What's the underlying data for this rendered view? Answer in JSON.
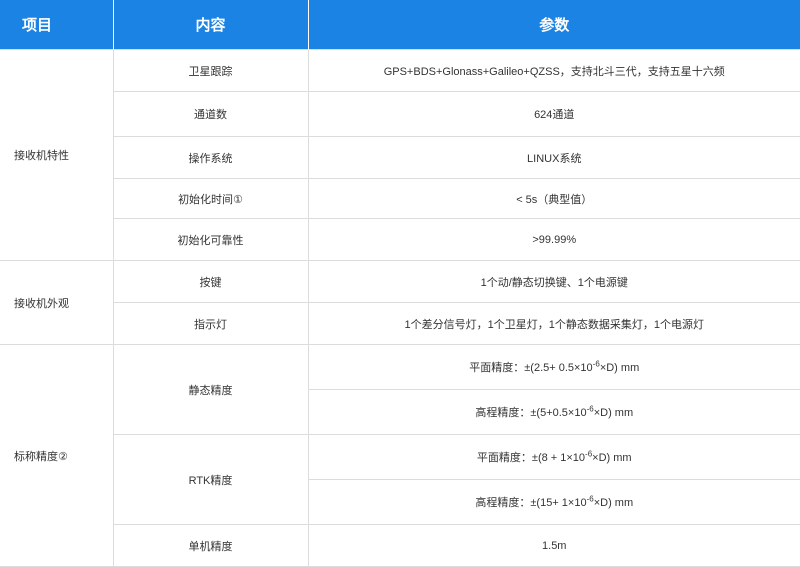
{
  "header": {
    "col1": "项目",
    "col2": "内容",
    "col3": "参数"
  },
  "groups": [
    {
      "label": "接收机特性",
      "rows": [
        {
          "item": "卫星跟踪",
          "value": "GPS+BDS+Glonass+Galileo+QZSS，支持北斗三代，支持五星十六频"
        },
        {
          "item": "通道数",
          "value": "624通道"
        },
        {
          "item": "操作系统",
          "value": "LINUX系统"
        },
        {
          "item": "初始化时间①",
          "value": "< 5s（典型值）"
        },
        {
          "item": "初始化可靠性",
          "value": ">99.99%"
        }
      ]
    },
    {
      "label": "接收机外观",
      "rows": [
        {
          "item": "按键",
          "value": "1个动/静态切换键、1个电源键"
        },
        {
          "item": "指示灯",
          "value": "1个差分信号灯，1个卫星灯，1个静态数据采集灯，1个电源灯"
        }
      ]
    },
    {
      "label": "标称精度②",
      "static": {
        "item": "静态精度",
        "planar": {
          "prefix": "平面精度：±(2.5+ 0.5×10",
          "exp": "-6",
          "suffix": "×D) mm"
        },
        "height": {
          "prefix": "高程精度：±(5+0.5×10",
          "exp": "-6",
          "suffix": "×D) mm"
        }
      },
      "rtk": {
        "item": "RTK精度",
        "planar": {
          "prefix": "平面精度：±(8 + 1×10",
          "exp": "-6",
          "suffix": "×D) mm"
        },
        "height": {
          "prefix": "高程精度：±(15+ 1×10",
          "exp": "-6",
          "suffix": "×D) mm"
        }
      },
      "single": {
        "item": "单机精度",
        "value": "1.5m"
      }
    }
  ]
}
